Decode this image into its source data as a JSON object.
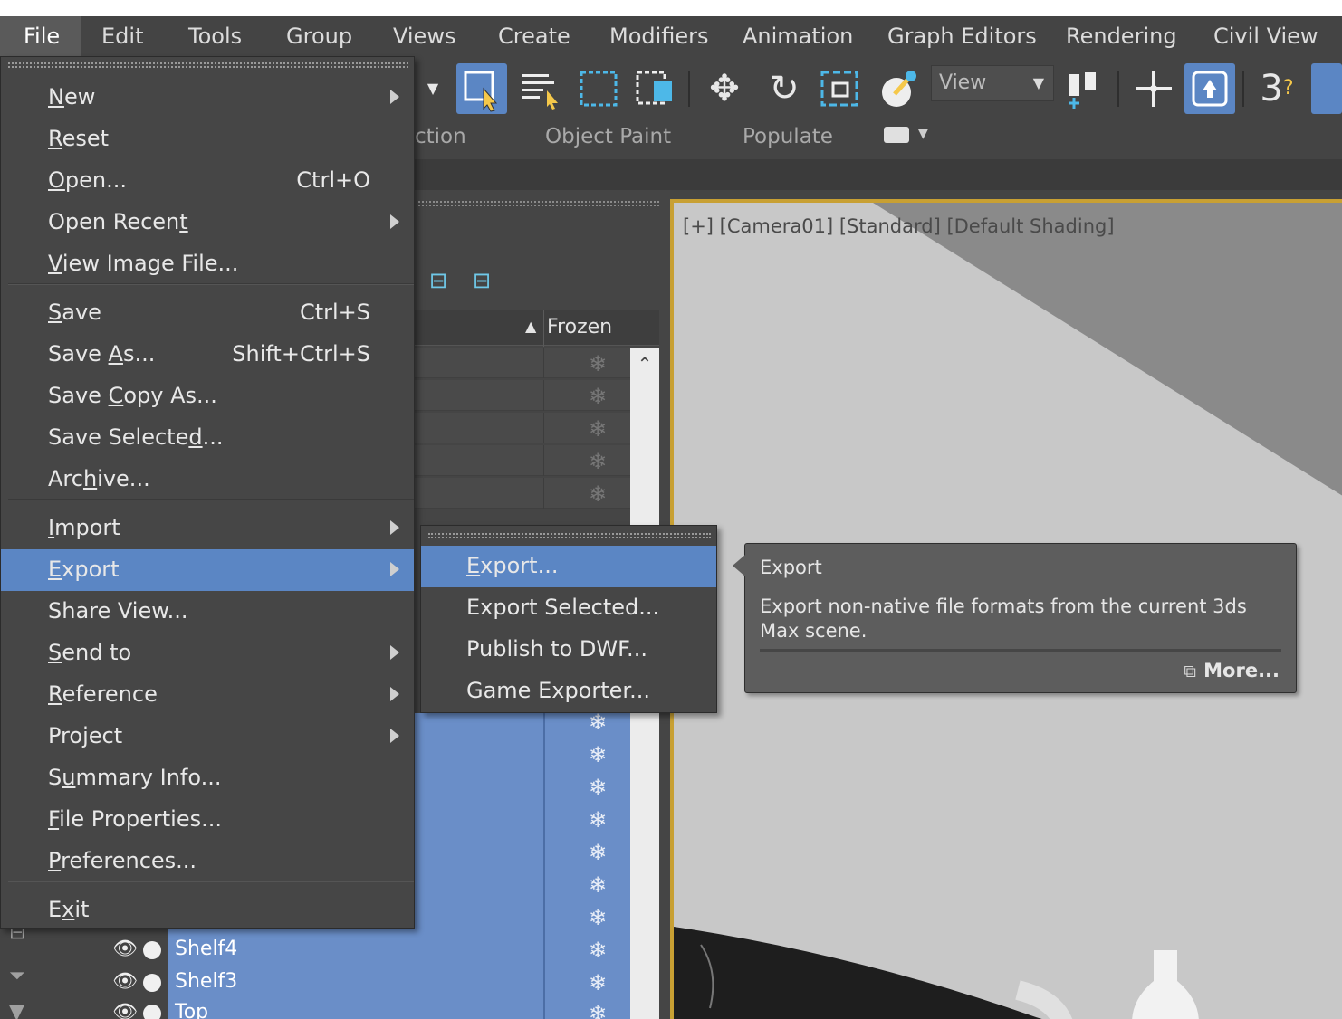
{
  "menubar": {
    "items": [
      "File",
      "Edit",
      "Tools",
      "Group",
      "Views",
      "Create",
      "Modifiers",
      "Animation",
      "Graph Editors",
      "Rendering",
      "Civil View"
    ]
  },
  "toolbar": {
    "view_selector": "View",
    "icons": [
      "select-object-icon",
      "select-by-name-icon",
      "rectangular-selection-icon",
      "window-crossing-icon",
      "move-icon",
      "rotate-icon",
      "scale-icon",
      "link-icon",
      "view-dropdown",
      "snap-icon",
      "pivot-icon",
      "percent-snap-icon",
      "angle-snap-icon"
    ]
  },
  "ribbon": {
    "tabs": [
      "ction",
      "Object Paint",
      "Populate"
    ]
  },
  "explorer": {
    "column_header": "Frozen",
    "visible_rows": [
      "Shelf4",
      "Shelf3",
      "Top"
    ]
  },
  "viewport": {
    "label": "[+] [Camera01] [Standard] [Default Shading]"
  },
  "file_menu": {
    "items": [
      {
        "pre": "",
        "u": "N",
        "post": "ew",
        "shortcut": "",
        "submenu": true
      },
      {
        "pre": "",
        "u": "R",
        "post": "eset",
        "shortcut": "",
        "submenu": false
      },
      {
        "pre": "",
        "u": "O",
        "post": "pen...",
        "shortcut": "Ctrl+O",
        "submenu": false
      },
      {
        "pre": "Open Recen",
        "u": "t",
        "post": "",
        "shortcut": "",
        "submenu": true
      },
      {
        "pre": "",
        "u": "V",
        "post": "iew Image File...",
        "shortcut": "",
        "submenu": false
      },
      {
        "pre": "",
        "u": "S",
        "post": "ave",
        "shortcut": "Ctrl+S",
        "submenu": false
      },
      {
        "pre": "Save ",
        "u": "A",
        "post": "s...",
        "shortcut": "Shift+Ctrl+S",
        "submenu": false
      },
      {
        "pre": "Save ",
        "u": "C",
        "post": "opy As...",
        "shortcut": "",
        "submenu": false
      },
      {
        "pre": "Save Selecte",
        "u": "d",
        "post": "...",
        "shortcut": "",
        "submenu": false
      },
      {
        "pre": "Arc",
        "u": "h",
        "post": "ive...",
        "shortcut": "",
        "submenu": false
      },
      {
        "pre": "",
        "u": "I",
        "post": "mport",
        "shortcut": "",
        "submenu": true
      },
      {
        "pre": "",
        "u": "E",
        "post": "xport",
        "shortcut": "",
        "submenu": true
      },
      {
        "pre": "Share View...",
        "u": "",
        "post": "",
        "shortcut": "",
        "submenu": false
      },
      {
        "pre": "",
        "u": "S",
        "post": "end to",
        "shortcut": "",
        "submenu": true
      },
      {
        "pre": "",
        "u": "R",
        "post": "eference",
        "shortcut": "",
        "submenu": true
      },
      {
        "pre": "Project",
        "u": "",
        "post": "",
        "shortcut": "",
        "submenu": true
      },
      {
        "pre": "S",
        "u": "u",
        "post": "mmary Info...",
        "shortcut": "",
        "submenu": false
      },
      {
        "pre": "",
        "u": "F",
        "post": "ile Properties...",
        "shortcut": "",
        "submenu": false
      },
      {
        "pre": "",
        "u": "P",
        "post": "references...",
        "shortcut": "",
        "submenu": false
      },
      {
        "pre": "E",
        "u": "x",
        "post": "it",
        "shortcut": "",
        "submenu": false
      }
    ]
  },
  "export_submenu": {
    "items": [
      {
        "pre": "",
        "u": "E",
        "post": "xport..."
      },
      {
        "pre": "Export Selected...",
        "u": "",
        "post": ""
      },
      {
        "pre": "Publish to DWF...",
        "u": "",
        "post": ""
      },
      {
        "pre": "Game Exporter...",
        "u": "",
        "post": ""
      }
    ]
  },
  "tooltip": {
    "title": "Export",
    "description": "Export non-native file formats from the current 3ds Max scene.",
    "more": "More..."
  },
  "colors": {
    "menu_bg": "#464646",
    "highlight": "#5b86c4",
    "selection": "#6a8ec8",
    "viewport_border": "#c8a033"
  }
}
